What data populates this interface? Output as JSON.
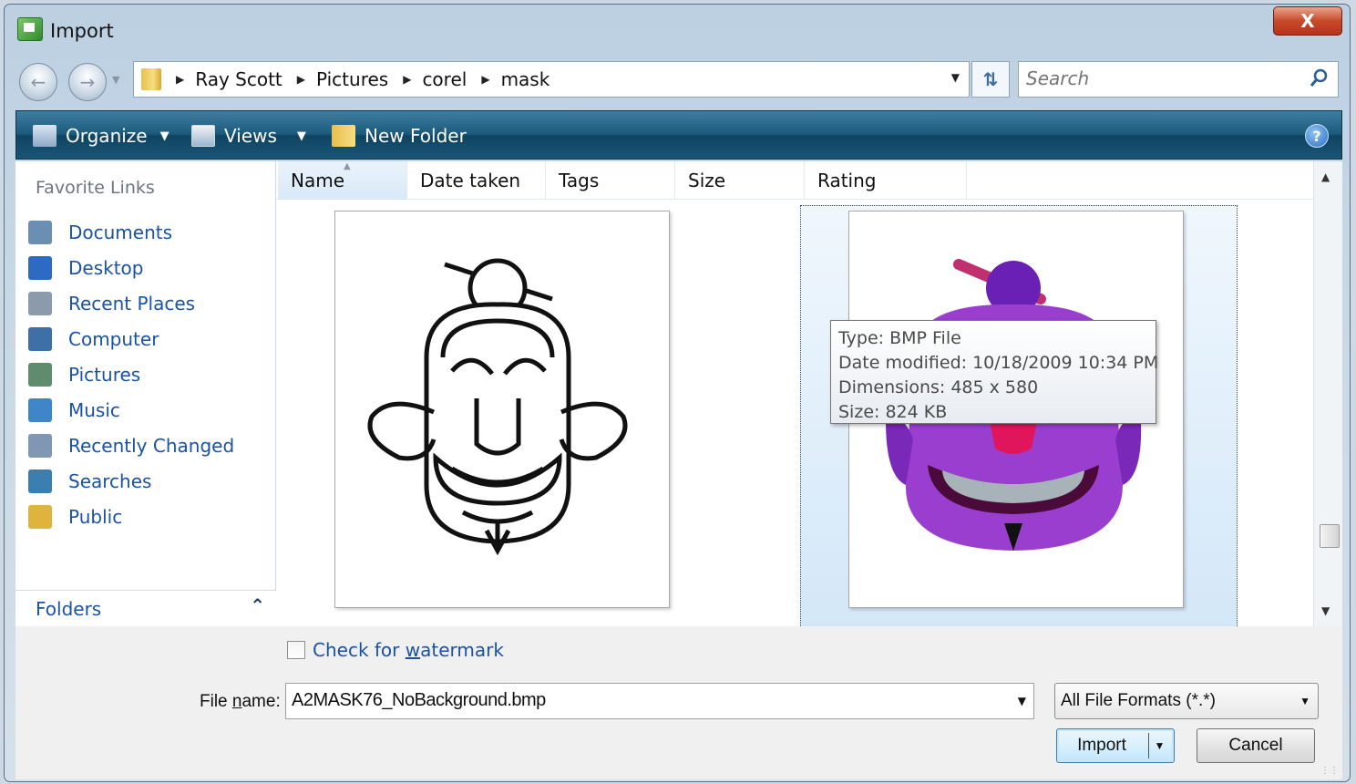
{
  "window": {
    "title": "Import",
    "close_label": "X"
  },
  "address": {
    "crumbs": [
      "Ray Scott",
      "Pictures",
      "corel",
      "mask"
    ],
    "search_placeholder": "Search"
  },
  "toolbar": {
    "organize": "Organize",
    "views": "Views",
    "new_folder": "New Folder",
    "help": "?"
  },
  "favorites": {
    "title": "Favorite Links",
    "items": [
      {
        "label": "Documents",
        "icon": "documents-icon",
        "color": "#6b8fb3"
      },
      {
        "label": "Desktop",
        "icon": "desktop-icon",
        "color": "#2d6bc2"
      },
      {
        "label": "Recent Places",
        "icon": "recent-places-icon",
        "color": "#8b9bab"
      },
      {
        "label": "Computer",
        "icon": "computer-icon",
        "color": "#3e6fa6"
      },
      {
        "label": "Pictures",
        "icon": "pictures-icon",
        "color": "#5f8c6c"
      },
      {
        "label": "Music",
        "icon": "music-icon",
        "color": "#3f86c9"
      },
      {
        "label": "Recently Changed",
        "icon": "recently-changed-icon",
        "color": "#7f97b4"
      },
      {
        "label": "Searches",
        "icon": "searches-icon",
        "color": "#3a7fb0"
      },
      {
        "label": "Public",
        "icon": "public-folder-icon",
        "color": "#e0b43c"
      }
    ],
    "folders_label": "Folders"
  },
  "columns": [
    "Name",
    "Date taken",
    "Tags",
    "Size",
    "Rating"
  ],
  "tooltip": {
    "type": "Type: BMP File",
    "modified": "Date modified: 10/18/2009 10:34 PM",
    "dimensions": "Dimensions: 485 x 580",
    "size": "Size: 824 KB"
  },
  "bottom": {
    "watermark_pre": "Check for ",
    "watermark_u": "w",
    "watermark_post": "atermark",
    "file_name_pre": "File ",
    "file_name_u": "n",
    "file_name_post": "ame:",
    "file_name_value": "A2MASK76_NoBackground.bmp",
    "file_format": "All File Formats (*.*)",
    "import_label": "Import",
    "cancel_label": "Cancel"
  },
  "colors": {
    "toolbar": "#1c5a7c",
    "link": "#1a53a3",
    "selection": "#d3e7f8"
  }
}
